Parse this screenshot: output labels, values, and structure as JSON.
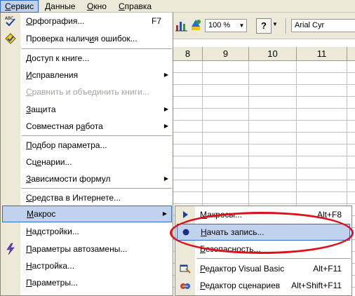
{
  "menubar": {
    "items": [
      {
        "label": "Сервис",
        "accel": "С",
        "rest": "ервис"
      },
      {
        "label": "Данные",
        "accel": "Д",
        "rest": "анные"
      },
      {
        "label": "Окно",
        "accel": "О",
        "rest": "кно"
      },
      {
        "label": "Справка",
        "accel": "С",
        "rest": "правка"
      }
    ]
  },
  "toolbar": {
    "zoom_value": "100 %",
    "font_name": "Arial Cyr",
    "help_glyph": "?"
  },
  "sheet": {
    "columns": [
      "8",
      "9",
      "10",
      "11"
    ]
  },
  "menu": {
    "items": [
      {
        "pre": "",
        "accel": "О",
        "post": "рфография...",
        "shortcut": "F7"
      },
      {
        "pre": "Проверка налич",
        "accel": "и",
        "post": "я ошибок..."
      },
      {
        "pre": "",
        "accel": "Д",
        "post": "оступ к книге..."
      },
      {
        "pre": "",
        "accel": "И",
        "post": "справления"
      },
      {
        "pre": "",
        "accel": "С",
        "post": "равнить и объединить книги..."
      },
      {
        "pre": "",
        "accel": "З",
        "post": "ащита"
      },
      {
        "pre": "Совместная р",
        "accel": "а",
        "post": "бота"
      },
      {
        "pre": "",
        "accel": "П",
        "post": "одбор параметра..."
      },
      {
        "pre": "Сц",
        "accel": "е",
        "post": "нарии..."
      },
      {
        "pre": "",
        "accel": "З",
        "post": "ависимости формул"
      },
      {
        "pre": "",
        "accel": "С",
        "post": "редства в Интернете..."
      },
      {
        "pre": "",
        "accel": "М",
        "post": "акрос"
      },
      {
        "pre": "",
        "accel": "Н",
        "post": "адстройки..."
      },
      {
        "pre": "",
        "accel": "П",
        "post": "араметры автозамены..."
      },
      {
        "pre": "",
        "accel": "Н",
        "post": "астройка..."
      },
      {
        "pre": "",
        "accel": "П",
        "post": "араметры..."
      }
    ]
  },
  "submenu": {
    "items": [
      {
        "pre": "",
        "accel": "М",
        "post": "акросы...",
        "shortcut": "Alt+F8"
      },
      {
        "pre": "",
        "accel": "Н",
        "post": "ачать запись..."
      },
      {
        "pre": "",
        "accel": "Б",
        "post": "езопасность..."
      },
      {
        "pre": "",
        "accel": "Р",
        "post": "едактор Visual Basic",
        "shortcut": "Alt+F11"
      },
      {
        "pre": "",
        "accel": "Р",
        "post": "едактор сценариев",
        "shortcut": "Alt+Shift+F11"
      }
    ]
  },
  "colors": {
    "highlight": "#c1d2ee",
    "highlight_border": "#316ac5",
    "annotation": "#e01018"
  }
}
